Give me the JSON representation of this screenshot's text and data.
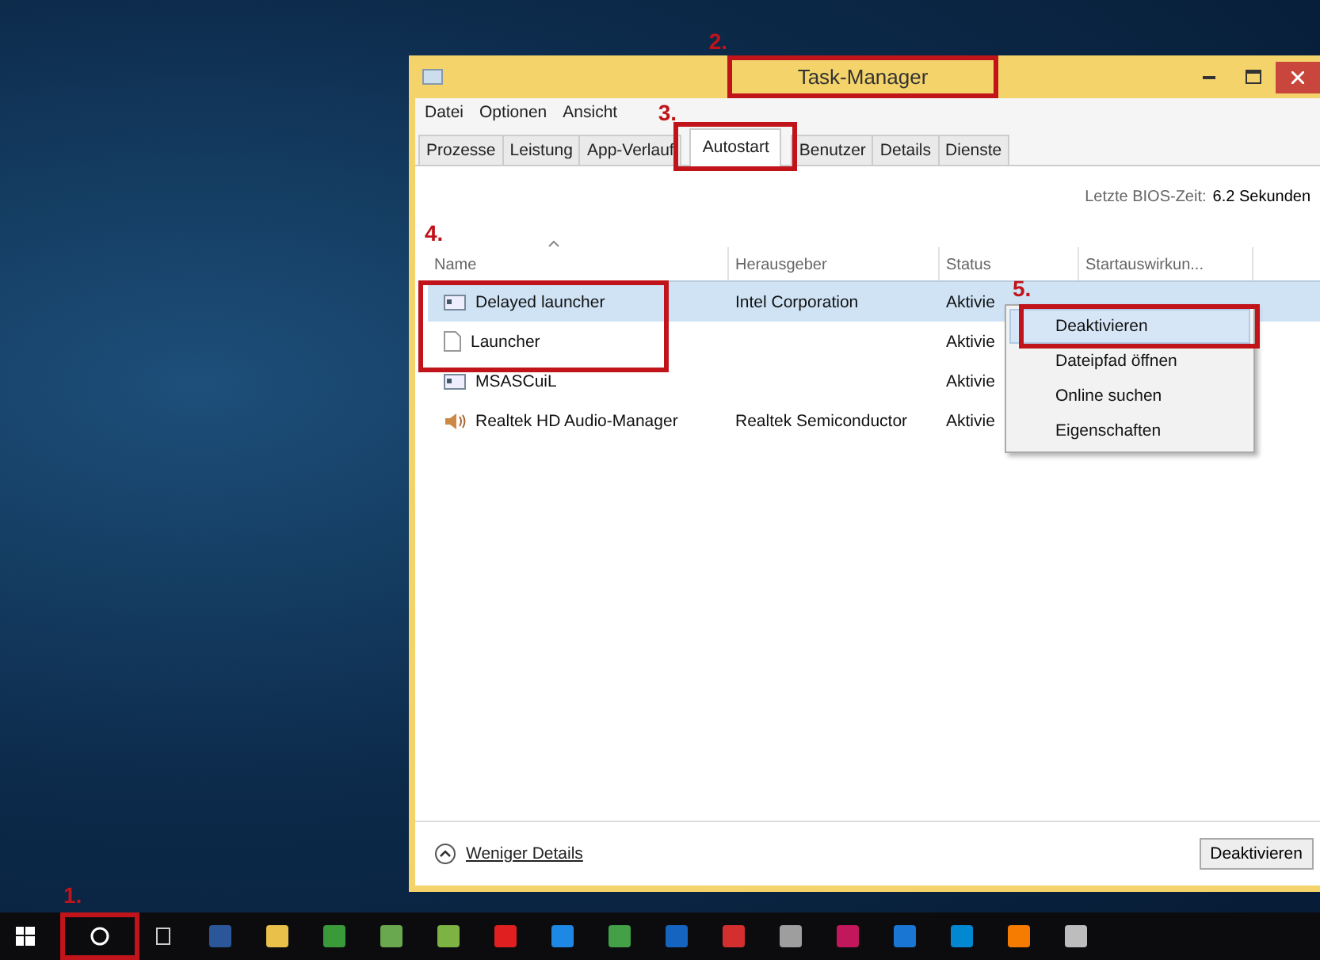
{
  "window": {
    "title": "Task-Manager"
  },
  "menu": [
    "Datei",
    "Optionen",
    "Ansicht"
  ],
  "tabs": [
    {
      "label": "Prozesse",
      "selected": false
    },
    {
      "label": "Leistung",
      "selected": false
    },
    {
      "label": "App-Verlauf",
      "selected": false
    },
    {
      "label": "Autostart",
      "selected": true
    },
    {
      "label": "Benutzer",
      "selected": false
    },
    {
      "label": "Details",
      "selected": false
    },
    {
      "label": "Dienste",
      "selected": false
    }
  ],
  "bios": {
    "label": "Letzte BIOS-Zeit:",
    "value": "6.2 Sekunden"
  },
  "table": {
    "columns": [
      "Name",
      "Herausgeber",
      "Status",
      "Startauswirkun..."
    ],
    "rows": [
      {
        "kind": "app",
        "name": "Delayed launcher",
        "publisher": "Intel Corporation",
        "status": "Aktivie",
        "selected": true
      },
      {
        "kind": "file",
        "name": "Launcher",
        "publisher": "",
        "status": "Aktivie",
        "selected": false
      },
      {
        "kind": "app",
        "name": "MSASCuiL",
        "publisher": "",
        "status": "Aktivie",
        "selected": false
      },
      {
        "kind": "speaker",
        "name": "Realtek HD Audio-Manager",
        "publisher": "Realtek Semiconductor",
        "status": "Aktivie",
        "selected": false
      }
    ]
  },
  "context_menu": [
    {
      "label": "Deaktivieren",
      "selected": true
    },
    {
      "label": "Dateipfad öffnen",
      "selected": false
    },
    {
      "label": "Online suchen",
      "selected": false
    },
    {
      "label": "Eigenschaften",
      "selected": false
    }
  ],
  "footer": {
    "details": "Weniger Details",
    "button": "Deaktivieren"
  },
  "annotations": [
    "1.",
    "2.",
    "3.",
    "4.",
    "5."
  ],
  "taskbar": {
    "apps": [
      {
        "color": "#2b579a"
      },
      {
        "color": "#e8c04a"
      },
      {
        "color": "#3a9a3a"
      },
      {
        "color": "#6aa84f"
      },
      {
        "color": "#7cb342"
      },
      {
        "color": "#e02020"
      },
      {
        "color": "#1e88e5"
      },
      {
        "color": "#43a047"
      },
      {
        "color": "#1565c0"
      },
      {
        "color": "#d32f2f"
      },
      {
        "color": "#9e9e9e"
      },
      {
        "color": "#c2185b"
      },
      {
        "color": "#1976d2"
      },
      {
        "color": "#0288d1"
      },
      {
        "color": "#f57c00"
      },
      {
        "color": "#bdbdbd"
      }
    ]
  }
}
